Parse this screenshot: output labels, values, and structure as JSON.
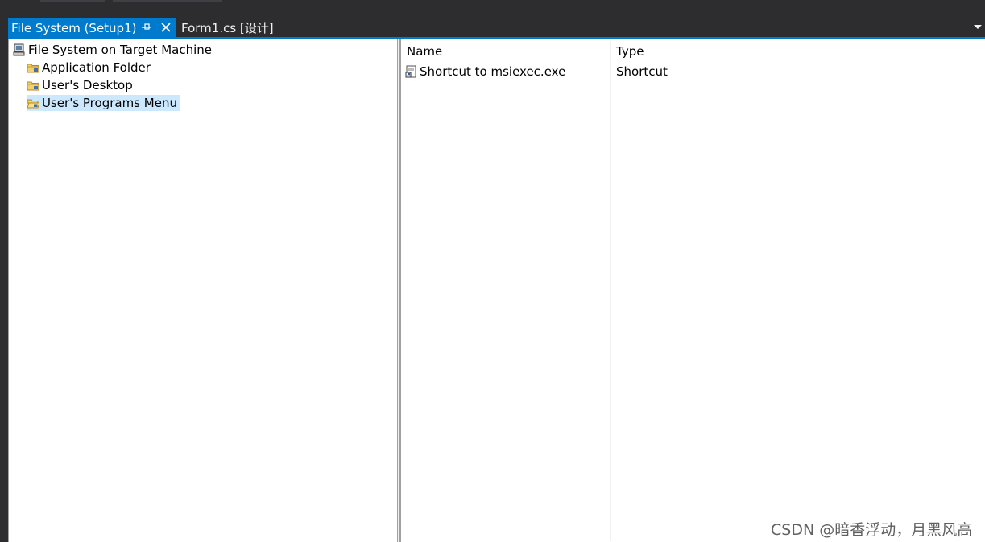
{
  "tabs": {
    "active": {
      "label": "File System (Setup1)"
    },
    "inactive": {
      "label": "Form1.cs [设计]"
    }
  },
  "tree": {
    "root": {
      "label": "File System on Target Machine",
      "icon": "computer-icon"
    },
    "items": [
      {
        "label": "Application Folder",
        "icon": "folder-icon"
      },
      {
        "label": "User's Desktop",
        "icon": "folder-icon"
      },
      {
        "label": "User's Programs Menu",
        "icon": "open-folder-icon",
        "selected": true
      }
    ]
  },
  "list": {
    "columns": [
      "Name",
      "Type"
    ],
    "rows": [
      {
        "name": "Shortcut to msiexec.exe",
        "type": "Shortcut",
        "icon": "shortcut-icon"
      }
    ]
  },
  "watermark": "CSDN @暗香浮动，月黑风高",
  "colors": {
    "accent": "#007acc",
    "chrome": "#2d2d30",
    "selection": "#cce8ff"
  }
}
